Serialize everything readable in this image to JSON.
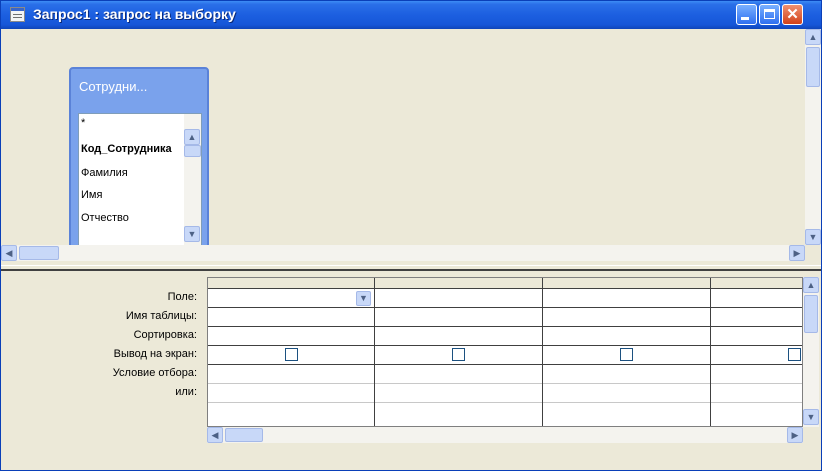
{
  "window": {
    "title": "Запрос1 : запрос на выборку",
    "controls": {
      "minimize": "_",
      "maximize": "□",
      "close": "✕"
    }
  },
  "table_box": {
    "title": "Сотрудни...",
    "fields": [
      "*",
      "Код_Сотрудника",
      "Фамилия",
      "Имя",
      "Отчество"
    ],
    "bold_field": "Код_Сотрудника"
  },
  "grid": {
    "row_labels": [
      "Поле:",
      "Имя таблицы:",
      "Сортировка:",
      "Вывод на экран:",
      "Условие отбора:",
      "или:"
    ],
    "columns": [
      {
        "field": "",
        "table": "",
        "sort": "",
        "show": false,
        "criteria": "",
        "or": ""
      },
      {
        "field": "",
        "table": "",
        "sort": "",
        "show": false,
        "criteria": "",
        "or": ""
      },
      {
        "field": "",
        "table": "",
        "sort": "",
        "show": false,
        "criteria": "",
        "or": ""
      },
      {
        "field": "",
        "table": "",
        "sort": "",
        "show": false,
        "criteria": "",
        "or": ""
      }
    ]
  },
  "icons": {
    "window_icon": "query-window-icon",
    "scroll_up": "▲",
    "scroll_down": "▼",
    "scroll_left": "◀",
    "scroll_right": "▶",
    "dropdown": "▼"
  },
  "colors": {
    "titlebar": "#1c5fe0",
    "table_header": "#7aa2ec",
    "window_bg": "#ece9d8"
  }
}
